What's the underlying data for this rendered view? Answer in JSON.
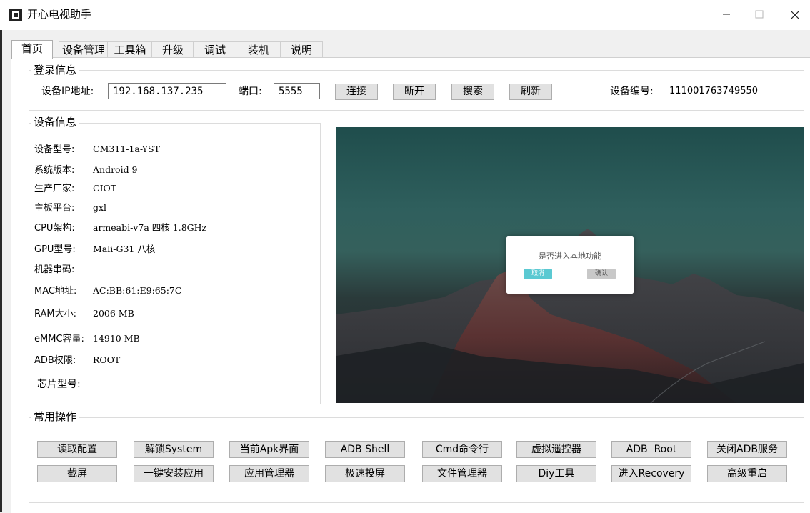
{
  "window": {
    "title": "开心电视助手"
  },
  "tabs": [
    {
      "label": "首页",
      "active": true
    },
    {
      "label": "设备管理",
      "active": false
    },
    {
      "label": "工具箱",
      "active": false
    },
    {
      "label": "升级",
      "active": false
    },
    {
      "label": "调试",
      "active": false
    },
    {
      "label": "装机",
      "active": false
    },
    {
      "label": "说明",
      "active": false
    }
  ],
  "login": {
    "group_label": "登录信息",
    "ip_label": "设备IP地址:",
    "ip_value": "192.168.137.235",
    "port_label": "端口:",
    "port_value": "5555",
    "buttons": [
      "连接",
      "断开",
      "搜索",
      "刷新"
    ],
    "device_id_label": "设备编号:",
    "device_id_value": "111001763749550"
  },
  "device_info": {
    "group_label": "设备信息",
    "rows": [
      {
        "key": "设备型号:",
        "value": "CM311-1a-YST"
      },
      {
        "key": "系统版本:",
        "value": "Android 9"
      },
      {
        "key": "生产厂家:",
        "value": "CIOT"
      },
      {
        "key": "主板平台:",
        "value": "gxl"
      },
      {
        "key": "CPU架构:",
        "value": "armeabi-v7a 四核 1.8GHz"
      },
      {
        "key": "GPU型号:",
        "value": "Mali-G31 八核"
      },
      {
        "key": "机器串码:",
        "value": ""
      },
      {
        "key": "MAC地址:",
        "value": "AC:BB:61:E9:65:7C"
      },
      {
        "key": "RAM大小:",
        "value": "2006 MB"
      },
      {
        "key": "eMMC容量:",
        "value": "14910 MB"
      },
      {
        "key": "ADB权限:",
        "value": "ROOT"
      },
      {
        "key": "芯片型号:",
        "value": ""
      }
    ]
  },
  "screen_preview": {
    "dialog_text": "是否进入本地功能",
    "cancel_label": "取消",
    "ok_label": "确认"
  },
  "operations": {
    "group_label": "常用操作",
    "row1": [
      "读取配置",
      "解锁System",
      "当前Apk界面",
      "ADB Shell",
      "Cmd命令行",
      "虚拟遥控器",
      "ADB  Root",
      "关闭ADB服务"
    ],
    "row2": [
      "截屏",
      "一键安装应用",
      "应用管理器",
      "极速投屏",
      "文件管理器",
      "Diy工具",
      "进入Recovery",
      "高级重启"
    ]
  },
  "colors": {
    "dialog_cancel": "#5bc9d2",
    "title_bar": "#ffffff",
    "client_bg": "#f0f0f0"
  }
}
